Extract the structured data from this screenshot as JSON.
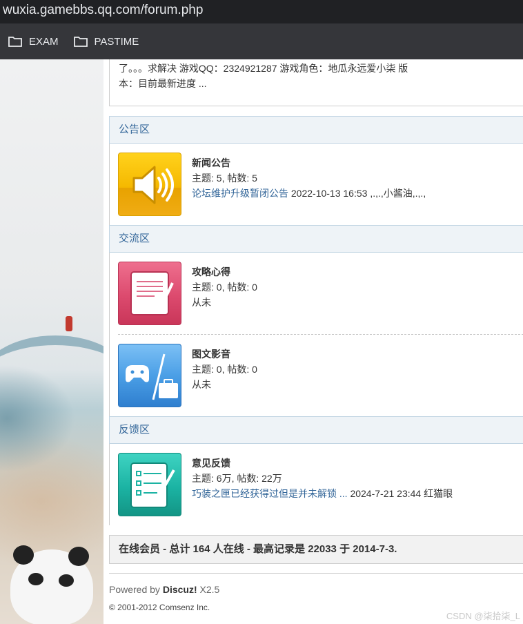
{
  "browser": {
    "url": "wuxia.gamebbs.qq.com/forum.php",
    "bookmarks": [
      {
        "label": "EXAM",
        "icon": "folder-icon"
      },
      {
        "label": "PASTIME",
        "icon": "folder-icon"
      }
    ]
  },
  "intro": {
    "line1": "了。。。求解决 游戏QQ：2324921287 游戏角色：地瓜永远爱小柒 版",
    "line2": "本：目前最新进度 ..."
  },
  "categories": [
    {
      "title": "公告区",
      "forums": [
        {
          "name": "新闻公告",
          "stats": "主题: 5, 帖数: 5",
          "last_link": "论坛维护升级暂闭公告",
          "last_meta": " 2022-10-13 16:53 ,.,.,小酱油,.,.,",
          "icon": "speaker-icon",
          "color": "#f2b705"
        }
      ]
    },
    {
      "title": "交流区",
      "forums": [
        {
          "name": "攻略心得",
          "stats": "主题: 0, 帖数: 0",
          "last": "从未",
          "icon": "notebook-icon",
          "color": "#d9466b"
        },
        {
          "name": "图文影音",
          "stats": "主题: 0, 帖数: 0",
          "last": "从未",
          "icon": "media-icon",
          "color": "#3b8fd8"
        }
      ]
    },
    {
      "title": "反馈区",
      "forums": [
        {
          "name": "意见反馈",
          "stats": "主题: 6万, 帖数: 22万",
          "last_link": "巧装之匣已经获得过但是并未解锁 ...",
          "last_meta": " 2024-7-21 23:44 红猫眼",
          "icon": "feedback-form-icon",
          "color": "#1bb3a3"
        }
      ]
    }
  ],
  "online": "在线会员 - 总计 164 人在线 - 最高记录是 22033 于 2014-7-3.",
  "footer": {
    "powered_prefix": "Powered by ",
    "brand": "Discuz!",
    "version": " X2.5",
    "copyright": "© 2001-2012 Comsenz Inc."
  },
  "watermark": "CSDN @柒拾柒_L"
}
